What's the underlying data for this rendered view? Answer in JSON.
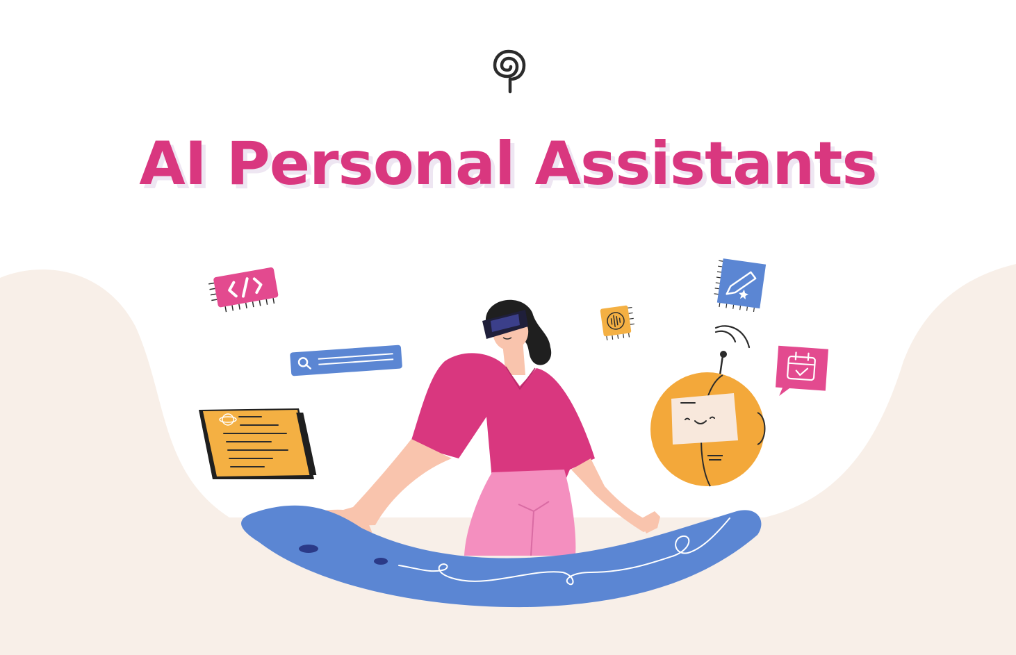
{
  "header": {
    "logo_icon": "spiral-pin-logo-icon"
  },
  "title": "AI Personal Assistants",
  "colors": {
    "title": "#d9377f",
    "title_shadow": "#eee6f2",
    "background": "#ffffff",
    "blob": "#f8efe8",
    "desk": "#5b86d3",
    "shirt": "#d9377f",
    "pants": "#f48fbf",
    "skin": "#f9c4ad",
    "robot": "#f3a83a",
    "tablet": "#f4b043",
    "search_bar": "#5b86d3"
  },
  "illustration": {
    "items": [
      "code-chip-icon",
      "search-bar-icon",
      "tablet-icon",
      "vr-woman-figure",
      "audio-chip-icon",
      "pen-notebook-icon",
      "robot-icon",
      "calendar-bubble-icon",
      "curved-desk"
    ]
  }
}
